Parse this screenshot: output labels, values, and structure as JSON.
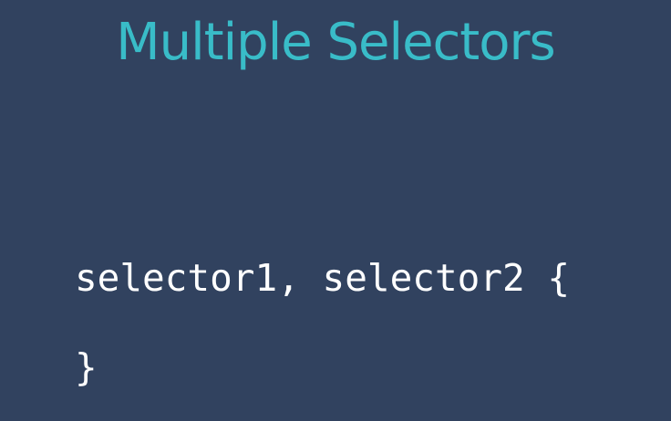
{
  "slide": {
    "title": "Multiple Selectors",
    "code_lines": [
      "selector1, selector2 {",
      "}"
    ],
    "colors": {
      "background": "#31425f",
      "title": "#39bcc8",
      "code": "#ffffff"
    }
  }
}
